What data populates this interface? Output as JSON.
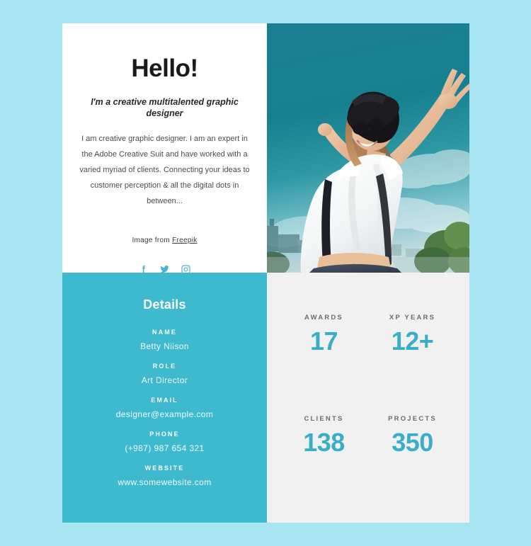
{
  "theme": {
    "page_background": "#a6e5f1",
    "accent_teal": "#3fb9cd",
    "stat_number_color": "#3aaec7",
    "stats_panel_background": "#f2f1f1",
    "intro_panel_background": "#ffffff"
  },
  "intro": {
    "heading": "Hello!",
    "subtitle": "I'm a creative multitalented graphic designer",
    "body": "I am creative graphic designer. I am an expert in the Adobe Creative Suit and have worked with a varied myriad of clients. Connecting your ideas to customer perception & all the digital dots in between...",
    "credit_prefix": "Image from",
    "credit_link": "Freepik",
    "socials": [
      {
        "name": "facebook",
        "icon": "facebook-icon"
      },
      {
        "name": "twitter",
        "icon": "twitter-icon"
      },
      {
        "name": "instagram",
        "icon": "instagram-icon"
      }
    ]
  },
  "photo": {
    "alt": "Woman with black hat and sunglasses raising arms against a teal sky"
  },
  "details": {
    "title": "Details",
    "fields": [
      {
        "label": "NAME",
        "value": "Betty Nilson"
      },
      {
        "label": "ROLE",
        "value": "Art Director"
      },
      {
        "label": "EMAIL",
        "value": "designer@example.com"
      },
      {
        "label": "PHONE",
        "value": "(+987) 987 654 321"
      },
      {
        "label": "WEBSITE",
        "value": "www.somewebsite.com"
      }
    ]
  },
  "stats": [
    {
      "label": "AWARDS",
      "value": "17"
    },
    {
      "label": "XP YEARS",
      "value": "12+"
    },
    {
      "label": "CLIENTS",
      "value": "138"
    },
    {
      "label": "PROJECTS",
      "value": "350"
    }
  ]
}
